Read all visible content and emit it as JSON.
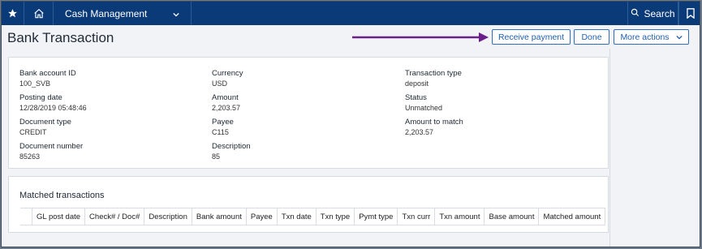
{
  "nav": {
    "module": "Cash Management",
    "search_label": "Search"
  },
  "page": {
    "title": "Bank Transaction",
    "buttons": {
      "receive_payment": "Receive payment",
      "done": "Done",
      "more_actions": "More actions"
    }
  },
  "fields": {
    "bank_account_id": {
      "label": "Bank account ID",
      "value": "100_SVB"
    },
    "posting_date": {
      "label": "Posting date",
      "value": "12/28/2019 05:48:46"
    },
    "document_type": {
      "label": "Document type",
      "value": "CREDIT"
    },
    "document_number": {
      "label": "Document number",
      "value": "85263"
    },
    "currency": {
      "label": "Currency",
      "value": "USD"
    },
    "amount": {
      "label": "Amount",
      "value": "2,203.57"
    },
    "payee": {
      "label": "Payee",
      "value": "C115"
    },
    "description": {
      "label": "Description",
      "value": "85"
    },
    "transaction_type": {
      "label": "Transaction type",
      "value": "deposit"
    },
    "status": {
      "label": "Status",
      "value": "Unmatched"
    },
    "amount_to_match": {
      "label": "Amount to match",
      "value": "2,203.57"
    }
  },
  "matched": {
    "title": "Matched transactions",
    "columns": [
      "GL post date",
      "Check# / Doc#",
      "Description",
      "Bank amount",
      "Payee",
      "Txn date",
      "Txn type",
      "Pymt type",
      "Txn curr",
      "Txn amount",
      "Base amount",
      "Matched amount"
    ]
  },
  "colors": {
    "nav_bg": "#0b3a78",
    "accent": "#1f5fb0",
    "annotation_arrow": "#6a1f8a"
  }
}
